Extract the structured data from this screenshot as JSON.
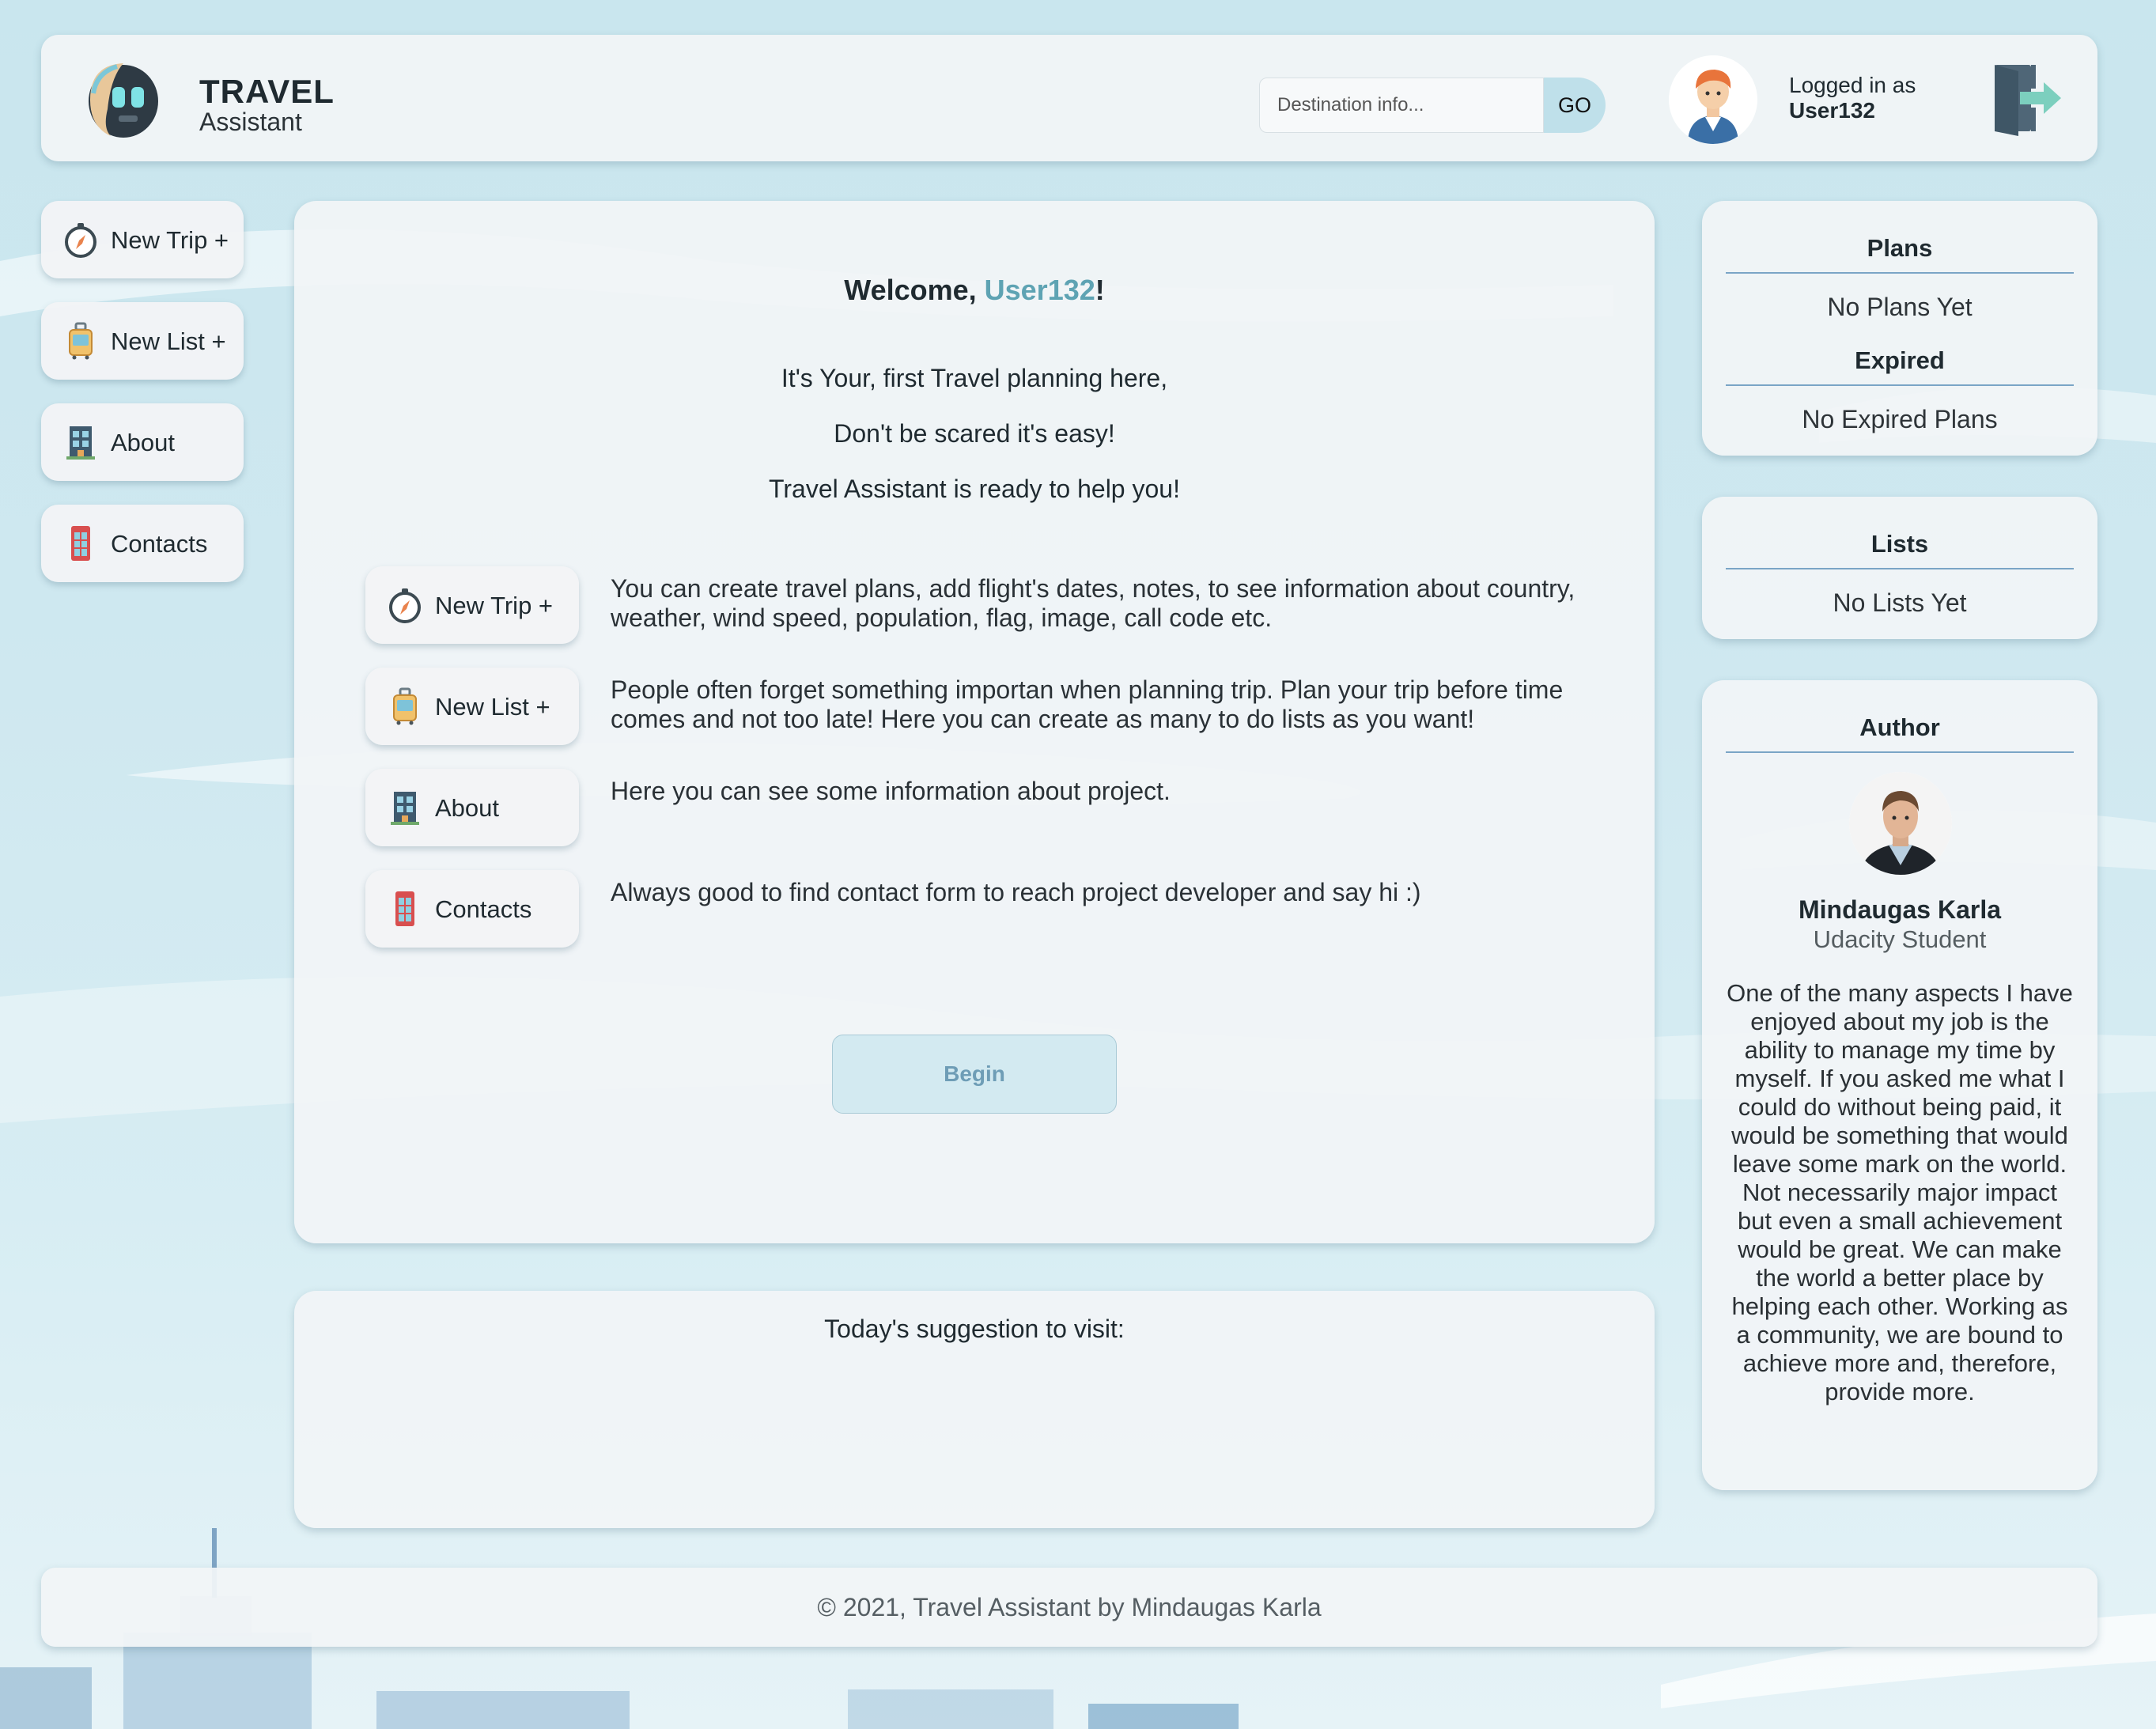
{
  "header": {
    "brand_title": "TRAVEL",
    "brand_subtitle": "Assistant",
    "search_placeholder": "Destination info...",
    "search_button": "GO",
    "logged_in_label": "Logged in as",
    "username": "User132"
  },
  "sidebar": {
    "items": [
      {
        "label": "New Trip +",
        "icon": "compass-icon"
      },
      {
        "label": "New List +",
        "icon": "luggage-icon"
      },
      {
        "label": "About",
        "icon": "building-icon"
      },
      {
        "label": "Contacts",
        "icon": "phone-booth-icon"
      }
    ]
  },
  "main": {
    "welcome_prefix": "Welcome, ",
    "welcome_user": "User132",
    "welcome_suffix": "!",
    "intro_lines": [
      "It's Your, first Travel planning here,",
      "Don't be scared it's easy!",
      "Travel Assistant is ready to help you!"
    ],
    "features": [
      {
        "label": "New Trip +",
        "icon": "compass-icon",
        "description": "You can create travel plans, add flight's dates, notes, to see information about country, weather, wind speed, population, flag, image, call code etc."
      },
      {
        "label": "New List +",
        "icon": "luggage-icon",
        "description": "People often forget something importan when planning trip. Plan your trip before time comes and not too late! Here you can create as many to do lists as you want!"
      },
      {
        "label": "About",
        "icon": "building-icon",
        "description": "Here you can see some information about project."
      },
      {
        "label": "Contacts",
        "icon": "phone-booth-icon",
        "description": "Always good to find contact form to reach project developer and say hi :)"
      }
    ],
    "begin_button": "Begin"
  },
  "suggestion": {
    "title": "Today's suggestion to visit:"
  },
  "plans_panel": {
    "plans_title": "Plans",
    "plans_empty": "No Plans Yet",
    "expired_title": "Expired",
    "expired_empty": "No Expired Plans"
  },
  "lists_panel": {
    "title": "Lists",
    "empty": "No Lists Yet"
  },
  "author_panel": {
    "title": "Author",
    "name": "Mindaugas Karla",
    "role": "Udacity Student",
    "bio": "One of the many aspects I have enjoyed about my job is the ability to manage my time by myself. If you asked me what I could do without being paid, it would be something that would leave some mark on the world. Not necessarily major impact but even a small achievement would be great. We can make the world a better place by helping each other. Working as a community, we are bound to achieve more and, therefore, provide more."
  },
  "footer": {
    "text": "© 2021, Travel Assistant by Mindaugas Karla"
  },
  "colors": {
    "accent": "#5ea3b3",
    "background": "#cfe8f0",
    "card": "#f1f4f6",
    "divider": "#7aa5c6",
    "begin_button": "#d3eaf1"
  }
}
